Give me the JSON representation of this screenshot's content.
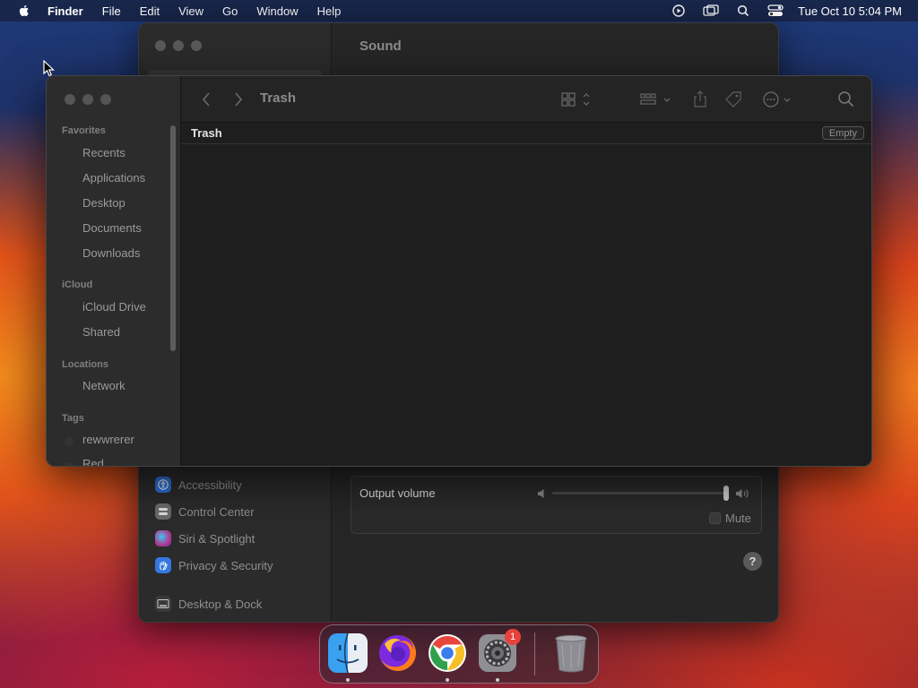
{
  "menubar": {
    "app_name": "Finder",
    "items": [
      "File",
      "Edit",
      "View",
      "Go",
      "Window",
      "Help"
    ],
    "clock": "Tue Oct 10  5:04 PM",
    "status_icons": [
      "screen-recording-icon",
      "screen-mirroring-icon",
      "spotlight-search-icon",
      "control-center-icon"
    ]
  },
  "settings_window": {
    "title": "Sound",
    "sidebar_items": [
      {
        "label": "Accessibility",
        "icon": "accessibility-icon",
        "color": "#2f6fd6"
      },
      {
        "label": "Control Center",
        "icon": "control-center-icon",
        "color": "#6b6b6b"
      },
      {
        "label": "Siri & Spotlight",
        "icon": "siri-icon",
        "color": "#b0388f"
      },
      {
        "label": "Privacy & Security",
        "icon": "hand-icon",
        "color": "#3478e0"
      },
      {
        "label": "Desktop & Dock",
        "icon": "desktop-dock-icon",
        "color": "#3a3a3a"
      }
    ],
    "output_volume_label": "Output volume",
    "output_volume_level": 0.98,
    "mute_label": "Mute",
    "mute_checked": false,
    "help_label": "?"
  },
  "finder": {
    "title": "Trash",
    "sidebar": {
      "favorites_header": "Favorites",
      "favorites": [
        "Recents",
        "Applications",
        "Desktop",
        "Documents",
        "Downloads"
      ],
      "icloud_header": "iCloud",
      "icloud": [
        "iCloud Drive",
        "Shared"
      ],
      "locations_header": "Locations",
      "locations": [
        "Network"
      ],
      "tags_header": "Tags",
      "tags": [
        "rewwrerer",
        "Red"
      ]
    },
    "toolbar_icons": [
      "back-icon",
      "forward-icon",
      "icon-view-icon",
      "group-icon",
      "share-icon",
      "tag-icon",
      "more-actions-icon",
      "search-icon"
    ],
    "content_header": "Trash",
    "empty_button": "Empty"
  },
  "dock": {
    "apps": [
      {
        "name": "Finder",
        "icon": "finder-icon",
        "running": true
      },
      {
        "name": "Firefox",
        "icon": "firefox-icon",
        "running": false
      },
      {
        "name": "Google Chrome",
        "icon": "chrome-icon",
        "running": true
      },
      {
        "name": "System Settings",
        "icon": "system-settings-icon",
        "running": true,
        "badge": "1"
      },
      {
        "name": "Trash",
        "icon": "trash-icon",
        "running": false
      }
    ]
  }
}
